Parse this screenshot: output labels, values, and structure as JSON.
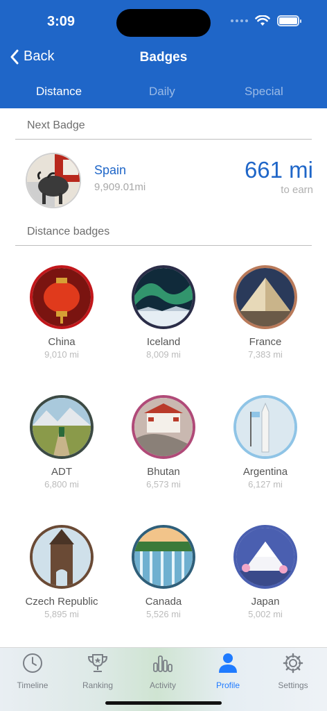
{
  "status_bar": {
    "time": "3:09"
  },
  "nav": {
    "back_label": "Back",
    "title": "Badges"
  },
  "tabs": [
    {
      "label": "Distance",
      "active": true
    },
    {
      "label": "Daily",
      "active": false
    },
    {
      "label": "Special",
      "active": false
    }
  ],
  "next_badge": {
    "section_title": "Next Badge",
    "name": "Spain",
    "distance": "9,909.01mi",
    "remaining": "661 mi",
    "remaining_caption": "to earn"
  },
  "distance_badges": {
    "section_title": "Distance badges",
    "items": [
      {
        "name": "China",
        "distance": "9,010 mi",
        "ring": "#c2171b"
      },
      {
        "name": "Iceland",
        "distance": "8,009 mi",
        "ring": "#2b2d48"
      },
      {
        "name": "France",
        "distance": "7,383 mi",
        "ring": "#b97a5a"
      },
      {
        "name": "ADT",
        "distance": "6,800 mi",
        "ring": "#3c4a44"
      },
      {
        "name": "Bhutan",
        "distance": "6,573 mi",
        "ring": "#b04a78"
      },
      {
        "name": "Argentina",
        "distance": "6,127 mi",
        "ring": "#8fc4e6"
      },
      {
        "name": "Czech Republic",
        "distance": "5,895 mi",
        "ring": "#6a4a35"
      },
      {
        "name": "Canada",
        "distance": "5,526 mi",
        "ring": "#2f5f7a"
      },
      {
        "name": "Japan",
        "distance": "5,002 mi",
        "ring": "#4a5fb0"
      }
    ]
  },
  "tabbar": [
    {
      "label": "Timeline",
      "icon": "clock-icon",
      "active": false
    },
    {
      "label": "Ranking",
      "icon": "trophy-icon",
      "active": false
    },
    {
      "label": "Activity",
      "icon": "bar-chart-icon",
      "active": false
    },
    {
      "label": "Profile",
      "icon": "person-icon",
      "active": true
    },
    {
      "label": "Settings",
      "icon": "gear-icon",
      "active": false
    }
  ],
  "colors": {
    "accent": "#1f66c8",
    "active_tab": "#1f7bff"
  }
}
